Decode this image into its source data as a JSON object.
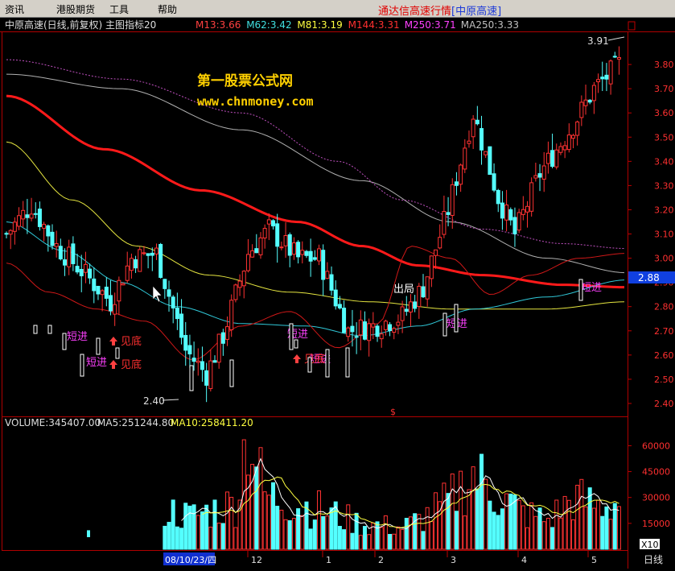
{
  "menu": {
    "items": [
      "资讯",
      "港股期货",
      "工具",
      "帮助"
    ],
    "app_title_prefix": "通达信高速行情",
    "app_title_stock": "[中原高速]"
  },
  "main_panel": {
    "header": "中原高速(日线,前复权) 主图指标20",
    "ma_items": [
      {
        "label": "M13:3.66",
        "color": "#ff4040"
      },
      {
        "label": "M62:3.42",
        "color": "#40e0e0"
      },
      {
        "label": "M81:3.19",
        "color": "#ffff40"
      },
      {
        "label": "M144:3.31",
        "color": "#ff3030"
      },
      {
        "label": "M250:3.71",
        "color": "#ff40ff"
      },
      {
        "label": "MA250:3.33",
        "color": "#c0c0c0"
      }
    ],
    "watermark_cn": "第一股票公式网",
    "watermark_url": "www.chnmoney.com",
    "price_ticks": [
      "3.80",
      "3.70",
      "3.60",
      "3.50",
      "3.40",
      "3.30",
      "3.20",
      "3.10",
      "3.00",
      "2.90",
      "2.80",
      "2.70",
      "2.60",
      "2.50",
      "2.40"
    ],
    "price_range": [
      2.35,
      3.93
    ],
    "current_price": "2.88",
    "high_label": "3.91",
    "low_label": "2.40",
    "signal_labels": {
      "short_in": "短进",
      "see_bottom": "见底",
      "exit": "出局",
      "dollar": "$"
    }
  },
  "volume_panel": {
    "vol_label": "VOLUME:345407.00",
    "ma5_label": "MA5:251244.80",
    "ma10_label": "MA10:258411.20",
    "vol_ticks": [
      "60000",
      "45000",
      "30000",
      "15000"
    ],
    "vol_range": [
      0,
      70000
    ],
    "unit": "X10"
  },
  "time_axis": {
    "selected_date": "08/10/23/四",
    "month_labels": [
      "12",
      "1",
      "2",
      "3",
      "4",
      "5"
    ],
    "period": "日线"
  },
  "colors": {
    "up": "#ff3232",
    "down": "#54ffff",
    "ma144": "#ff1a1a",
    "ma81": "#e6e640",
    "ma62": "#30c8d8",
    "ma250": "#b0b0b0",
    "m250": "#c050c0",
    "m13": "#d01818",
    "signal": "#ff40ff"
  }
}
